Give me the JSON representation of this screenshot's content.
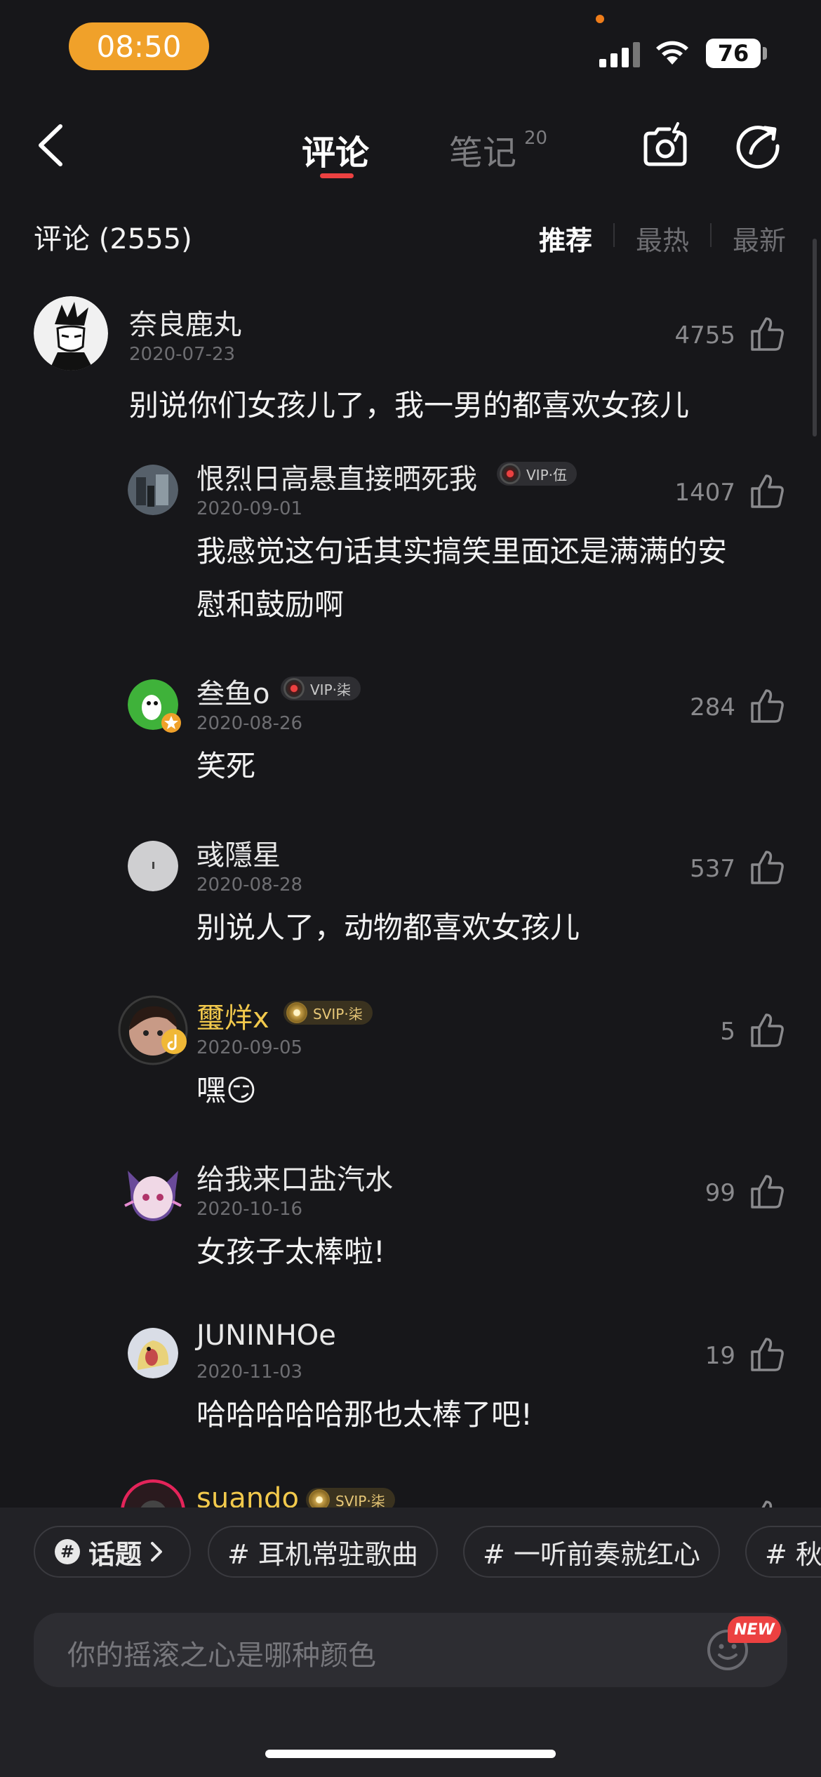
{
  "status_bar": {
    "time": "08:50",
    "battery": "76"
  },
  "header": {
    "tabs": [
      {
        "label": "评论",
        "active": true
      },
      {
        "label": "笔记",
        "count": "20",
        "active": false
      }
    ],
    "icons": [
      "back-icon",
      "camera-icon",
      "share-icon"
    ]
  },
  "comments_section": {
    "title": "评论 (2555)",
    "sort_options": [
      "推荐",
      "最热",
      "最新"
    ],
    "active_sort": "推荐"
  },
  "top_comment": {
    "user": "奈良鹿丸",
    "date": "2020-07-23",
    "likes": "4755",
    "text": "别说你们女孩儿了，我一男的都喜欢女孩儿"
  },
  "replies": [
    {
      "user": "恨烈日高悬直接晒死我",
      "badge": "VIP·伍",
      "date": "2020-09-01",
      "likes": "1407",
      "text_lines": [
        "我感觉这句话其实搞笑里面还是满满的安",
        "慰和鼓励啊"
      ]
    },
    {
      "user": "叁鱼o",
      "badge": "VIP·柒",
      "date": "2020-08-26",
      "likes": "284",
      "text": "笑死"
    },
    {
      "user": "彧隱星",
      "date": "2020-08-28",
      "likes": "537",
      "text": "别说人了，动物都喜欢女孩儿"
    },
    {
      "user": "璽烊x",
      "badge": "SVIP·柒",
      "date": "2020-09-05",
      "likes": "5",
      "text": "嘿",
      "emoji": "😏"
    },
    {
      "user": "给我来口盐汽水",
      "date": "2020-10-16",
      "likes": "99",
      "text": "女孩子太棒啦!"
    },
    {
      "user": "JUNINHOe",
      "date": "2020-11-03",
      "likes": "19",
      "text": "哈哈哈哈哈那也太棒了吧!"
    },
    {
      "user": "suando",
      "badge": "SVIP·柒"
    }
  ],
  "bottom": {
    "topic_label": "话题",
    "chips": [
      "# 耳机常驻歌曲",
      "# 一听前奏就红心",
      "# 秋"
    ],
    "input_placeholder": "你的摇滚之心是哪种颜色",
    "new_badge": "NEW"
  },
  "colors": {
    "accent": "#ec4141",
    "background": "#17171a",
    "time_pill": "#f0a12a",
    "svip_name": "#f2c94c"
  }
}
